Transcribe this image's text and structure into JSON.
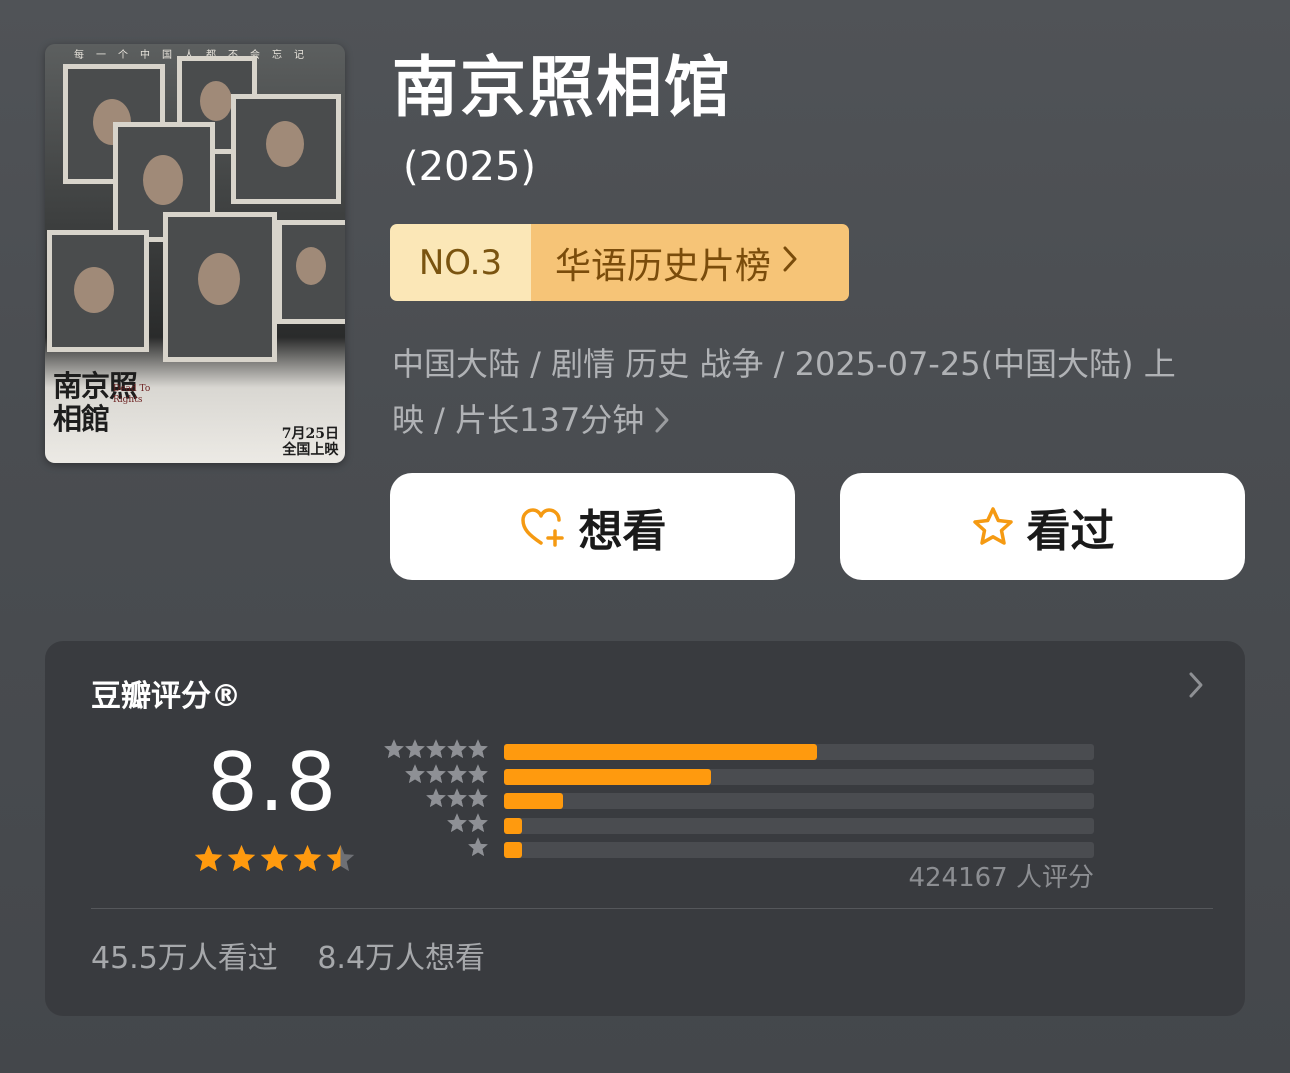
{
  "movie": {
    "title": "南京照相馆",
    "year": "(2025)",
    "rank_number": "NO.3",
    "rank_list": "华语历史片榜",
    "meta_line1": "中国大陆 / 剧情 历史 战争 / 2025-07-25(中国大陆) 上",
    "meta_line2": "映 / 片长137分钟",
    "poster": {
      "topline": "每一个中国人都不会忘记",
      "title": "南京照相館",
      "en_title": "Dead To Rights",
      "date": "7月25日",
      "release": "全国上映"
    }
  },
  "actions": {
    "want_label": "想看",
    "seen_label": "看过"
  },
  "rating": {
    "header": "豆瓣评分®",
    "score": "8.8",
    "score_stars": 4.5,
    "distribution": [
      {
        "stars": 5,
        "fraction": 0.53
      },
      {
        "stars": 4,
        "fraction": 0.35
      },
      {
        "stars": 3,
        "fraction": 0.1
      },
      {
        "stars": 2,
        "fraction": 0.03
      },
      {
        "stars": 1,
        "fraction": 0.03
      }
    ],
    "count": "424167 人评分",
    "seen_count": "45.5万人看过",
    "want_count": "8.4万人想看"
  },
  "colors": {
    "accent": "#ff9a0e",
    "rank_number_bg": "#fbe7b7",
    "rank_list_bg": "#f6c477",
    "card_bg": "#393b3f"
  },
  "icons": {
    "want": "heart-plus-icon",
    "seen": "star-outline-icon",
    "chevron": "chevron-right-icon"
  }
}
